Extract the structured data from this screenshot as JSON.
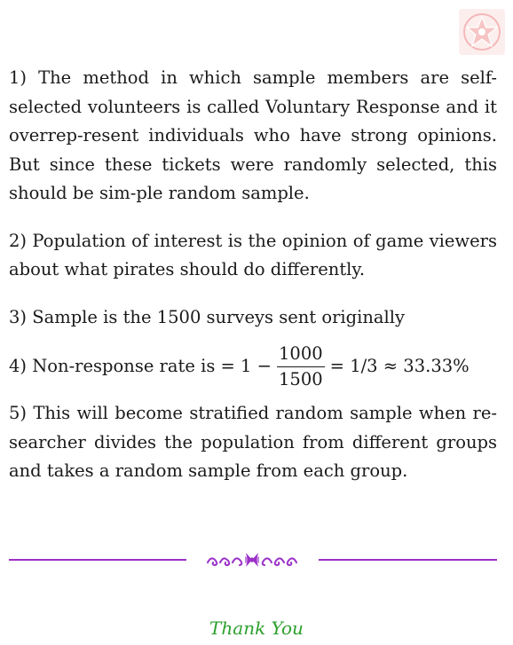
{
  "answers": {
    "a1": "1) The method in which sample members are self-selected volunteers is called Voluntary Response and it overrep-resent individuals who have strong opinions. But since these tickets were randomly selected, this should be sim-ple random sample.",
    "a2": "2) Population of interest is the opinion of game viewers about what pirates should do differently.",
    "a3": "3) Sample is the 1500 surveys sent originally",
    "a4": {
      "prefix": "4) Non-response rate is = 1 −",
      "numerator": "1000",
      "denominator": "1500",
      "suffix": "= 1/3 ≈ 33.33%"
    },
    "a5": "5) This will become stratified random sample when re-searcher divides the population from different groups and takes a random sample from each group."
  },
  "footer": {
    "thanks": "Thank You"
  },
  "colors": {
    "divider": "#9b30c8",
    "thanks": "#2ca02c",
    "logo_bg": "#fdeeee"
  },
  "icons": {
    "logo": "star-in-circle-logo",
    "ornament": "floral-divider-ornament"
  }
}
